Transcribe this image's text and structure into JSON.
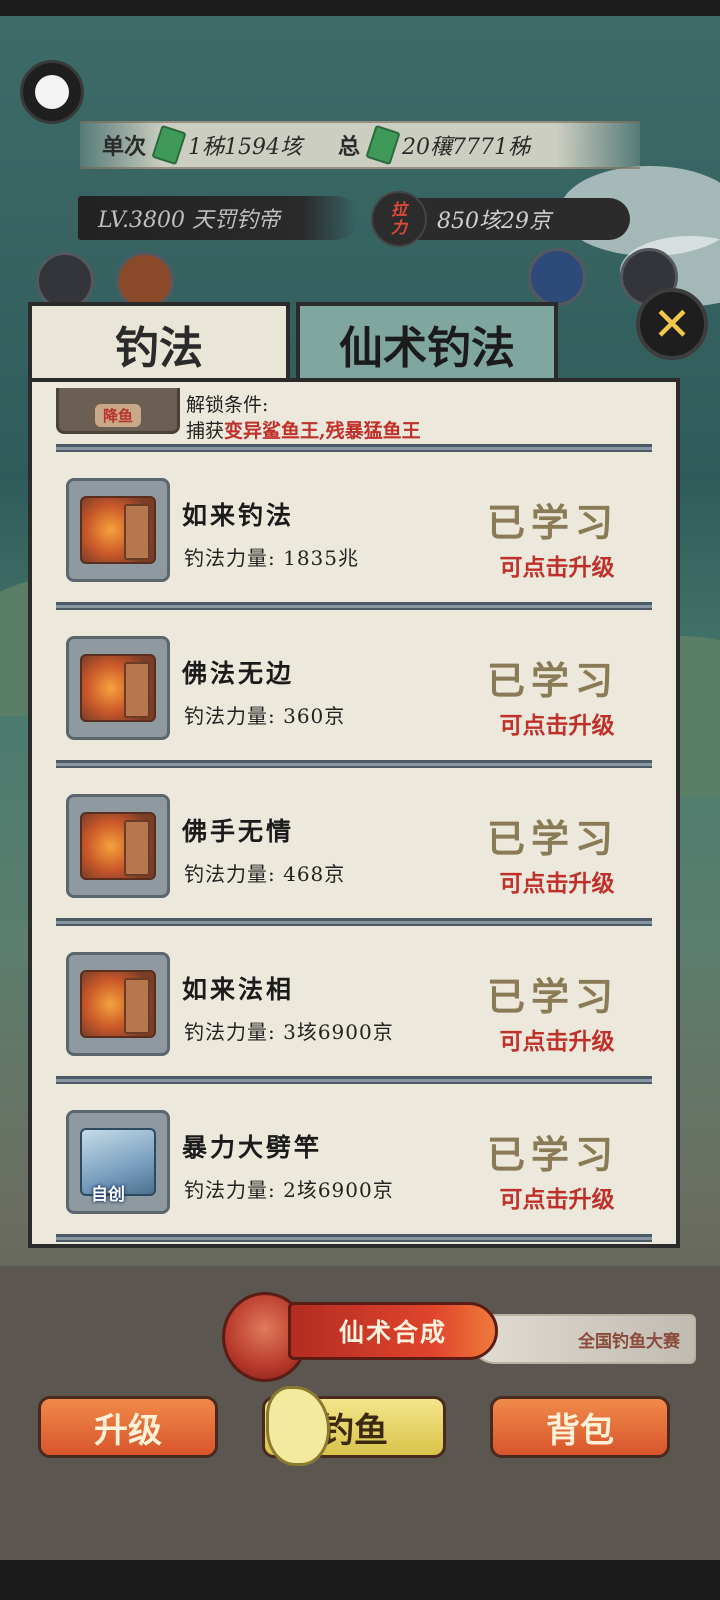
{
  "header": {
    "single_label": "单次",
    "single_value": "1秭1594垓",
    "total_label": "总",
    "total_value": "20穰7771秭",
    "level_text": "LV.3800 天罚钓帝",
    "power_icon_top": "拉",
    "power_icon_bottom": "力",
    "power_value": "850垓29京"
  },
  "tabs": {
    "fishing_method": "钓法",
    "immortal_method": "仙术钓法"
  },
  "close_icon": "close-icon",
  "unlock": {
    "icon_label": "降鱼",
    "line1": "解锁条件:",
    "line2_prefix": "捕获",
    "line2_targets": "变异鲨鱼王,残暴猛鱼王"
  },
  "skills": [
    {
      "name": "如来钓法",
      "power_label": "钓法力量:",
      "power_value": "1835兆",
      "status": "已学习",
      "upgrade": "可点击升级",
      "icon": "fiery-book-icon",
      "icon_tag": ""
    },
    {
      "name": "佛法无边",
      "power_label": "钓法力量:",
      "power_value": "360京",
      "status": "已学习",
      "upgrade": "可点击升级",
      "icon": "fiery-book-icon",
      "icon_tag": ""
    },
    {
      "name": "佛手无情",
      "power_label": "钓法力量:",
      "power_value": "468京",
      "status": "已学习",
      "upgrade": "可点击升级",
      "icon": "fiery-book-icon",
      "icon_tag": ""
    },
    {
      "name": "如来法相",
      "power_label": "钓法力量:",
      "power_value": "3垓6900京",
      "status": "已学习",
      "upgrade": "可点击升级",
      "icon": "fiery-book-icon",
      "icon_tag": ""
    },
    {
      "name": "暴力大劈竿",
      "power_label": "钓法力量:",
      "power_value": "2垓6900京",
      "status": "已学习",
      "upgrade": "可点击升级",
      "icon": "blue-book-icon",
      "icon_tag": "自创"
    }
  ],
  "bottom": {
    "compose": "仙术合成",
    "contest": "全国钓鱼大赛",
    "upgrade": "升级",
    "fish": "钓鱼",
    "bag": "背包"
  },
  "colors": {
    "accent_red": "#c0302a",
    "learned_gold": "#8a7a56",
    "panel_bg": "#ece9dc"
  }
}
